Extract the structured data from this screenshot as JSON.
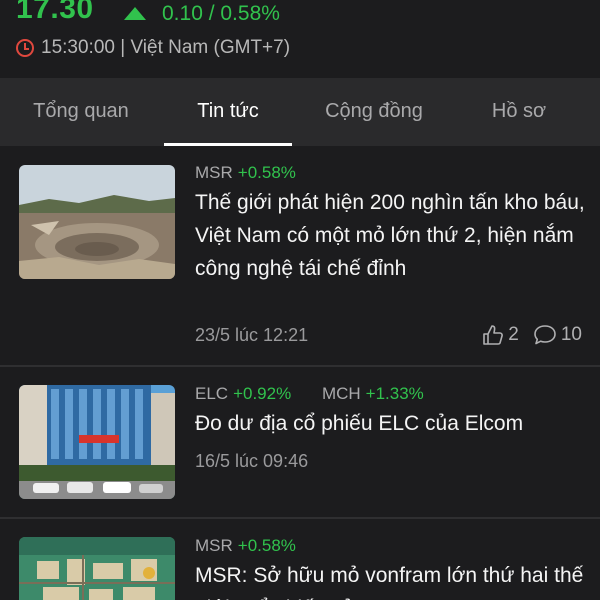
{
  "quote": {
    "price": "17.30",
    "change": "0.10 / 0.58%",
    "time": "15:30:00 | Việt Nam (GMT+7)"
  },
  "tabs": [
    {
      "label": "Tổng quan"
    },
    {
      "label": "Tin tức"
    },
    {
      "label": "Cộng đồng"
    },
    {
      "label": "Hồ sơ"
    }
  ],
  "articles": [
    {
      "tickers": [
        {
          "symbol": "MSR",
          "change": "+0.58%"
        }
      ],
      "headline": "Thế giới phát hiện 200 nghìn tấn kho báu, Việt Nam có một mỏ lớn thứ 2, hiện nắm công nghệ tái chế đỉnh",
      "date": "23/5 lúc 12:21",
      "likes": "2",
      "comments": "10"
    },
    {
      "tickers": [
        {
          "symbol": "ELC",
          "change": "+0.92%"
        },
        {
          "symbol": "MCH",
          "change": "+1.33%"
        }
      ],
      "headline": "Đo dư địa cổ phiếu ELC của Elcom",
      "date": "16/5 lúc 09:46"
    },
    {
      "tickers": [
        {
          "symbol": "MSR",
          "change": "+0.58%"
        }
      ],
      "headline": "MSR: Sở hữu mỏ vonfram lớn thứ hai thế giới, Cổ phiếu của Ma"
    }
  ],
  "colors": {
    "up": "#31c24d",
    "accent_clock": "#e0483e",
    "background": "#1c1c1e",
    "tab_bg": "#2a2a2c"
  }
}
